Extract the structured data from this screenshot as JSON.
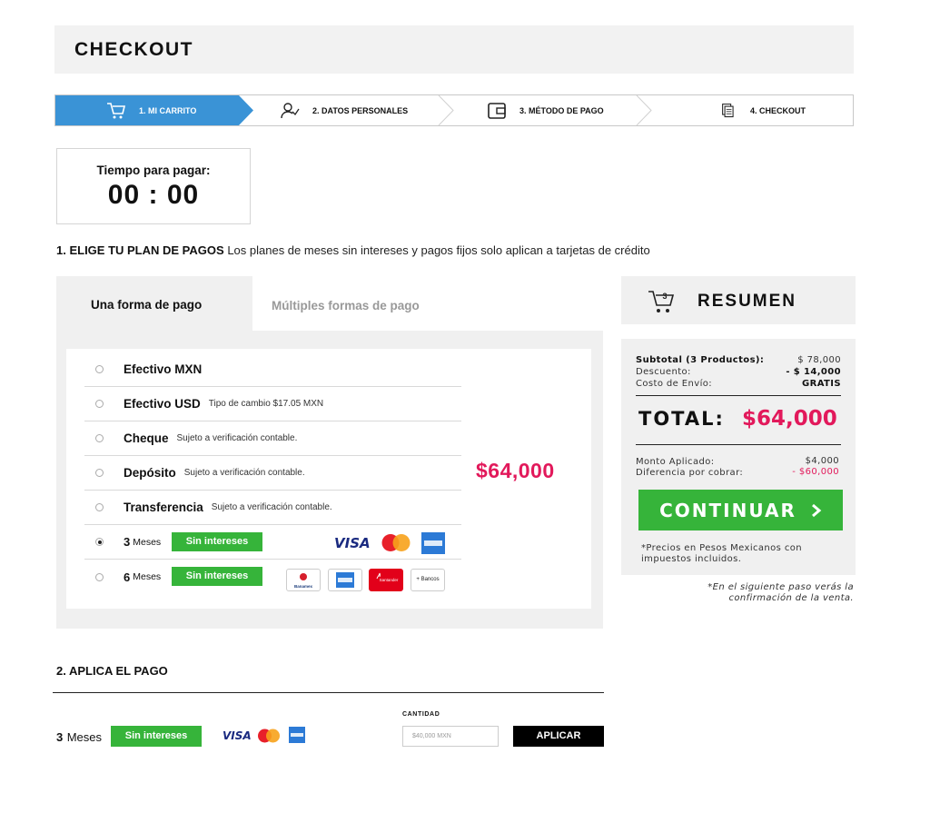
{
  "header": {
    "title": "CHECKOUT"
  },
  "steps": [
    {
      "label": "1. MI CARRITO",
      "icon": "cart-icon",
      "active": true
    },
    {
      "label": "2. DATOS PERSONALES",
      "icon": "user-icon",
      "active": false
    },
    {
      "label": "3. MÉTODO DE PAGO",
      "icon": "wallet-icon",
      "active": false
    },
    {
      "label": "4. CHECKOUT",
      "icon": "document-icon",
      "active": false
    }
  ],
  "timer": {
    "label": "Tiempo para pagar:",
    "value": "00 : 00"
  },
  "section1": {
    "title": "1. ELIGE TU PLAN DE PAGOS",
    "subtitle": "Los planes de meses sin intereses y pagos fijos solo aplican a tarjetas de crédito"
  },
  "tabs": {
    "active": "Una forma de pago",
    "inactive": "Múltiples formas de pago"
  },
  "payment_methods": [
    {
      "name": "Efectivo MXN",
      "note": ""
    },
    {
      "name": "Efectivo USD",
      "note": "Tipo de cambio $17.05 MXN"
    },
    {
      "name": "Cheque",
      "note": "Sujeto a verificación contable."
    },
    {
      "name": "Depósito",
      "note": "Sujeto a verificación contable."
    },
    {
      "name": "Transferencia",
      "note": "Sujeto a verificación contable."
    }
  ],
  "installments": [
    {
      "num": "3",
      "text": "Meses",
      "badge": "Sin intereses",
      "selected": true
    },
    {
      "num": "6",
      "text": "Meses",
      "badge": "Sin intereses",
      "selected": false
    }
  ],
  "cards": {
    "visa": "VISA",
    "mastercard": "MasterCard"
  },
  "banks": {
    "banamex": "Banamex",
    "santander": "Santander",
    "more": "+ Bancos"
  },
  "price": "$64,000",
  "summary": {
    "title": "RESUMEN",
    "cart_count": "3",
    "subtotal_label": "Subtotal (3 Productos):",
    "subtotal_value": "$ 78,000",
    "discount_label": "Descuento:",
    "discount_value": "- $ 14,000",
    "shipping_label": "Costo de Envío:",
    "shipping_value": "GRATIS",
    "total_label": "TOTAL:",
    "total_value": "$64,000",
    "applied_label": "Monto Aplicado:",
    "applied_value": "$4,000",
    "diff_label": "Diferencia por cobrar:",
    "diff_value": "- $60,000",
    "continue_label": "CONTINUAR",
    "prices_note": "*Precios en Pesos Mexicanos con impuestos incluidos.",
    "confirm_note": "*En el siguiente paso verás la confirmación de la venta."
  },
  "section2": {
    "title": "2. APLICA EL PAGO",
    "months_num": "3",
    "months_text": "Meses",
    "badge": "Sin intereses",
    "quantity_label": "CANTIDAD",
    "quantity_placeholder": "$40,000 MXN",
    "apply_label": "APLICAR"
  },
  "colors": {
    "accent_blue": "#3a93d6",
    "green": "#36b43a",
    "price_red": "#e2195b"
  }
}
